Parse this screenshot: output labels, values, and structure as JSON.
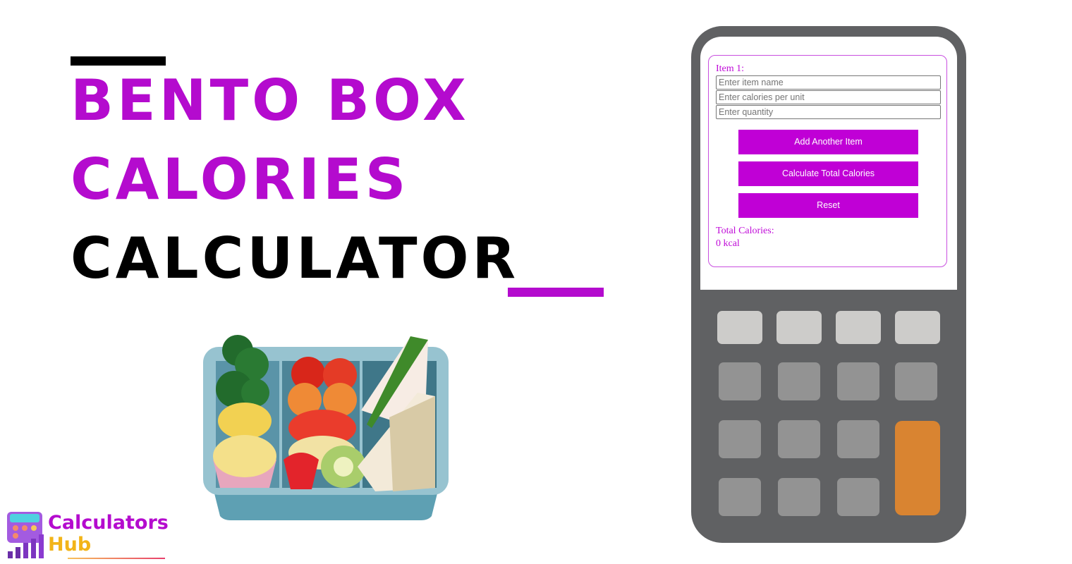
{
  "title": {
    "line1": "BENTO BOX",
    "line2": "CALORIES",
    "line3": "CALCULATOR",
    "accent_color": "#b40bce",
    "dark_color": "#000000"
  },
  "illustration": {
    "icon": "bento-box-illustration"
  },
  "logo": {
    "word1": "Calculators",
    "word2": "Hub",
    "word1_color": "#b40bce",
    "word2_color": "#f2b418"
  },
  "calculator": {
    "item_label": "Item 1:",
    "fields": {
      "name_placeholder": "Enter item name",
      "calories_placeholder": "Enter calories per unit",
      "quantity_placeholder": "Enter quantity",
      "name_value": "",
      "calories_value": "",
      "quantity_value": ""
    },
    "buttons": {
      "add": "Add Another Item",
      "calculate": "Calculate Total Calories",
      "reset": "Reset"
    },
    "result": {
      "label": "Total Calories:",
      "value": "0 kcal"
    },
    "button_color": "#c000d6",
    "body_color": "#606163",
    "equals_key_color": "#d98431"
  }
}
